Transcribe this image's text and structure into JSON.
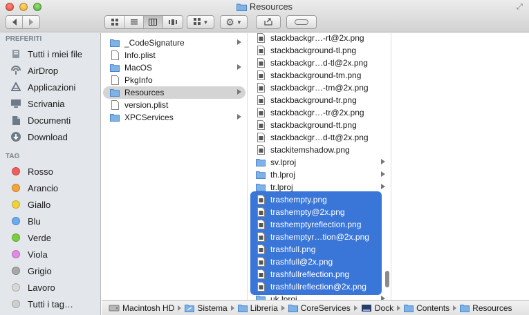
{
  "window": {
    "title": "Resources"
  },
  "sidebar": {
    "favorites_header": "PREFERITI",
    "favorites": [
      {
        "label": "Tutti i miei file",
        "icon": "all-files-icon"
      },
      {
        "label": "AirDrop",
        "icon": "airdrop-icon"
      },
      {
        "label": "Applicazioni",
        "icon": "applications-icon"
      },
      {
        "label": "Scrivania",
        "icon": "desktop-icon"
      },
      {
        "label": "Documenti",
        "icon": "documents-icon"
      },
      {
        "label": "Download",
        "icon": "download-icon"
      }
    ],
    "tags_header": "TAG",
    "tags": [
      {
        "label": "Rosso",
        "color": "#f25d5d"
      },
      {
        "label": "Arancio",
        "color": "#f5a33a"
      },
      {
        "label": "Giallo",
        "color": "#f2d23c"
      },
      {
        "label": "Blu",
        "color": "#6aabf0"
      },
      {
        "label": "Verde",
        "color": "#7acf3e"
      },
      {
        "label": "Viola",
        "color": "#e28ae6"
      },
      {
        "label": "Grigio",
        "color": "#a8a8a8"
      },
      {
        "label": "Lavoro",
        "color": "#d8d8d8"
      },
      {
        "label": "Tutti i tag…",
        "color": "#cfcfcf"
      }
    ]
  },
  "column1": [
    {
      "name": "_CodeSignature",
      "kind": "folder",
      "has_children": true
    },
    {
      "name": "Info.plist",
      "kind": "file",
      "has_children": false
    },
    {
      "name": "MacOS",
      "kind": "folder",
      "has_children": true
    },
    {
      "name": "PkgInfo",
      "kind": "file",
      "has_children": false
    },
    {
      "name": "Resources",
      "kind": "folder",
      "has_children": true,
      "selected": true
    },
    {
      "name": "version.plist",
      "kind": "file",
      "has_children": false
    },
    {
      "name": "XPCServices",
      "kind": "folder",
      "has_children": true
    }
  ],
  "column2": [
    {
      "name": "stackbackgr…-rt@2x.png",
      "kind": "image"
    },
    {
      "name": "stackbackground-tl.png",
      "kind": "image"
    },
    {
      "name": "stackbackgr…d-tl@2x.png",
      "kind": "image"
    },
    {
      "name": "stackbackground-tm.png",
      "kind": "image"
    },
    {
      "name": "stackbackgr…-tm@2x.png",
      "kind": "image"
    },
    {
      "name": "stackbackground-tr.png",
      "kind": "image"
    },
    {
      "name": "stackbackgr…-tr@2x.png",
      "kind": "image"
    },
    {
      "name": "stackbackground-tt.png",
      "kind": "image"
    },
    {
      "name": "stackbackgr…d-tt@2x.png",
      "kind": "image"
    },
    {
      "name": "stackitemshadow.png",
      "kind": "image"
    },
    {
      "name": "sv.lproj",
      "kind": "folder",
      "has_children": true
    },
    {
      "name": "th.lproj",
      "kind": "folder",
      "has_children": true
    },
    {
      "name": "tr.lproj",
      "kind": "folder",
      "has_children": true
    },
    {
      "name": "trashempty.png",
      "kind": "image",
      "selected": true
    },
    {
      "name": "trashempty@2x.png",
      "kind": "image",
      "selected": true
    },
    {
      "name": "trashemptyreflection.png",
      "kind": "image",
      "selected": true
    },
    {
      "name": "trashemptyr…tion@2x.png",
      "kind": "image",
      "selected": true
    },
    {
      "name": "trashfull.png",
      "kind": "image",
      "selected": true
    },
    {
      "name": "trashfull@2x.png",
      "kind": "image",
      "selected": true
    },
    {
      "name": "trashfullreflection.png",
      "kind": "image",
      "selected": true
    },
    {
      "name": "trashfullreflection@2x.png",
      "kind": "image",
      "selected": true
    },
    {
      "name": "uk.lproj",
      "kind": "folder",
      "has_children": true
    }
  ],
  "pathbar": [
    {
      "label": "Macintosh HD",
      "icon": "hard-drive-icon"
    },
    {
      "label": "Sistema",
      "icon": "system-folder-icon"
    },
    {
      "label": "Libreria",
      "icon": "folder-icon"
    },
    {
      "label": "CoreServices",
      "icon": "folder-icon"
    },
    {
      "label": "Dock",
      "icon": "dock-icon"
    },
    {
      "label": "Contents",
      "icon": "folder-icon"
    },
    {
      "label": "Resources",
      "icon": "folder-icon"
    }
  ],
  "colors": {
    "selection_blue": "#3a76d8",
    "sidebar_bg": "#e3e7ec",
    "folder_blue": "#7fb2e6"
  }
}
